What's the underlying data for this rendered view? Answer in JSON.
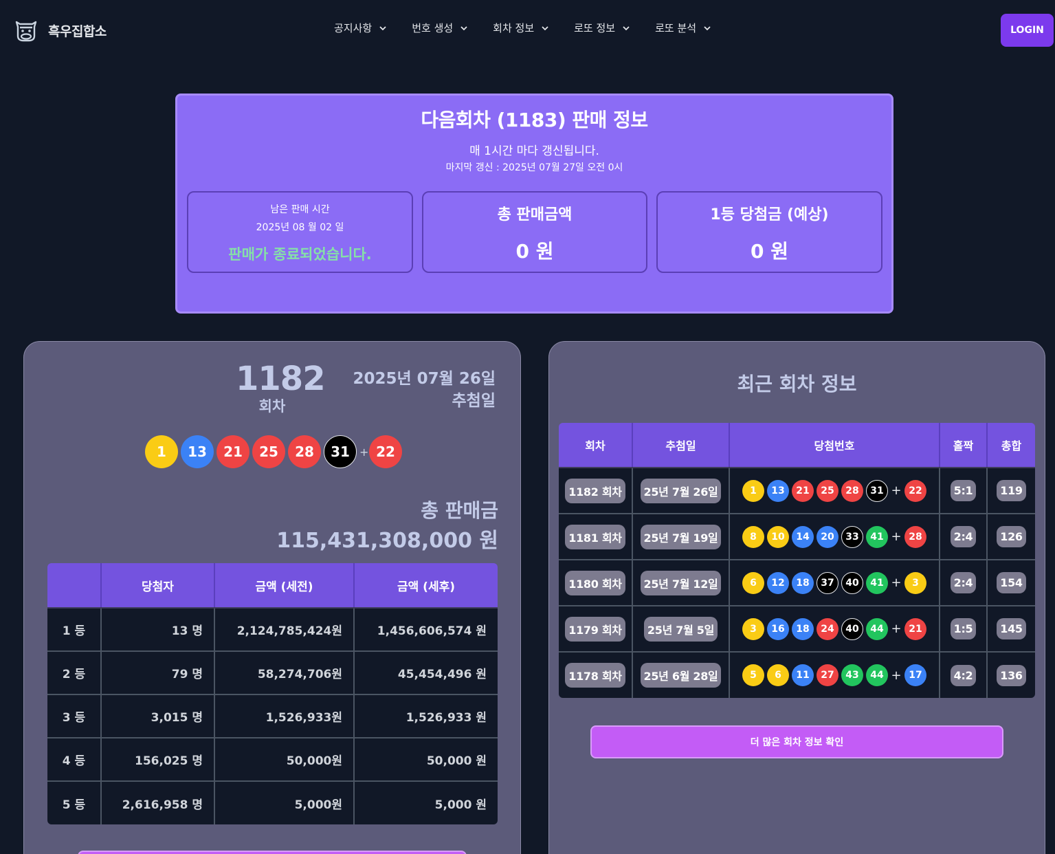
{
  "header": {
    "logo_text": "흑우집합소",
    "nav": [
      {
        "label": "공지사항"
      },
      {
        "label": "번호 생성"
      },
      {
        "label": "회차 정보"
      },
      {
        "label": "로또 정보"
      },
      {
        "label": "로또 분석"
      }
    ],
    "login_label": "LOGIN"
  },
  "sales_info": {
    "title": "다음회차 (1183) 판매 정보",
    "subtitle": "매 1시간 마다 갱신됩니다.",
    "last_updated": "마지막 갱신 : 2025년 07월 27일 오전 0시",
    "remaining": {
      "label": "남은 판매 시간",
      "date": "2025년 08 월 02 일",
      "status": "판매가 종료되었습니다."
    },
    "total_sales": {
      "label": "총 판매금액",
      "value": "0 원"
    },
    "first_prize": {
      "label": "1등 당첨금 (예상)",
      "value": "0 원"
    }
  },
  "latest_draw": {
    "number": "1182",
    "number_unit": "회차",
    "date": "2025년 07월 26일",
    "date_label": "추첨일",
    "balls": [
      {
        "n": "1",
        "color": "#facc15"
      },
      {
        "n": "13",
        "color": "#3b82f6"
      },
      {
        "n": "21",
        "color": "#ef4444"
      },
      {
        "n": "25",
        "color": "#ef4444"
      },
      {
        "n": "28",
        "color": "#ef4444"
      },
      {
        "n": "31",
        "color": "#000000"
      }
    ],
    "plus": "+",
    "bonus": {
      "n": "22",
      "color": "#ef4444"
    },
    "total_sales_label": "총 판매금",
    "total_sales_value": "115,431,308,000 원",
    "prize_table": {
      "headers": [
        "",
        "당첨자",
        "금액 (세전)",
        "금액 (세후)"
      ],
      "rows": [
        [
          "1 등",
          "13 명",
          "2,124,785,424원",
          "1,456,606,574 원"
        ],
        [
          "2 등",
          "79 명",
          "58,274,706원",
          "45,454,496 원"
        ],
        [
          "3 등",
          "3,015 명",
          "1,526,933원",
          "1,526,933 원"
        ],
        [
          "4 등",
          "156,025 명",
          "50,000원",
          "50,000 원"
        ],
        [
          "5 등",
          "2,616,958 명",
          "5,000원",
          "5,000 원"
        ]
      ]
    }
  },
  "recent": {
    "title": "최근 회차 정보",
    "headers": [
      "회차",
      "추첨일",
      "당첨번호",
      "홀짝",
      "총합"
    ],
    "rows": [
      {
        "round": "1182 회차",
        "date": "25년 7월 26일",
        "balls": [
          [
            "1",
            "yellow"
          ],
          [
            "13",
            "blue"
          ],
          [
            "21",
            "red"
          ],
          [
            "25",
            "red"
          ],
          [
            "28",
            "red"
          ],
          [
            "31",
            "black"
          ]
        ],
        "bonus": [
          "22",
          "red"
        ],
        "odd_even": "5:1",
        "sum": "119"
      },
      {
        "round": "1181 회차",
        "date": "25년 7월 19일",
        "balls": [
          [
            "8",
            "yellow"
          ],
          [
            "10",
            "yellow"
          ],
          [
            "14",
            "blue"
          ],
          [
            "20",
            "blue"
          ],
          [
            "33",
            "black"
          ],
          [
            "41",
            "green"
          ]
        ],
        "bonus": [
          "28",
          "red"
        ],
        "odd_even": "2:4",
        "sum": "126"
      },
      {
        "round": "1180 회차",
        "date": "25년 7월 12일",
        "balls": [
          [
            "6",
            "yellow"
          ],
          [
            "12",
            "blue"
          ],
          [
            "18",
            "blue"
          ],
          [
            "37",
            "black"
          ],
          [
            "40",
            "black"
          ],
          [
            "41",
            "green"
          ]
        ],
        "bonus": [
          "3",
          "yellow"
        ],
        "odd_even": "2:4",
        "sum": "154"
      },
      {
        "round": "1179 회차",
        "date": "25년 7월 5일",
        "balls": [
          [
            "3",
            "yellow"
          ],
          [
            "16",
            "blue"
          ],
          [
            "18",
            "blue"
          ],
          [
            "24",
            "red"
          ],
          [
            "40",
            "black"
          ],
          [
            "44",
            "green"
          ]
        ],
        "bonus": [
          "21",
          "red"
        ],
        "odd_even": "1:5",
        "sum": "145"
      },
      {
        "round": "1178 회차",
        "date": "25년 6월 28일",
        "balls": [
          [
            "5",
            "yellow"
          ],
          [
            "6",
            "yellow"
          ],
          [
            "11",
            "blue"
          ],
          [
            "27",
            "red"
          ],
          [
            "43",
            "green"
          ],
          [
            "44",
            "green"
          ]
        ],
        "bonus": [
          "17",
          "blue"
        ],
        "odd_even": "4:2",
        "sum": "136"
      }
    ],
    "more_label": "더 많은 회차 정보 확인"
  },
  "colors": {
    "yellow": "#facc15",
    "blue": "#3b82f6",
    "red": "#ef4444",
    "black": "#000000",
    "green": "#22c55e",
    "accent": "#7c3aed"
  }
}
